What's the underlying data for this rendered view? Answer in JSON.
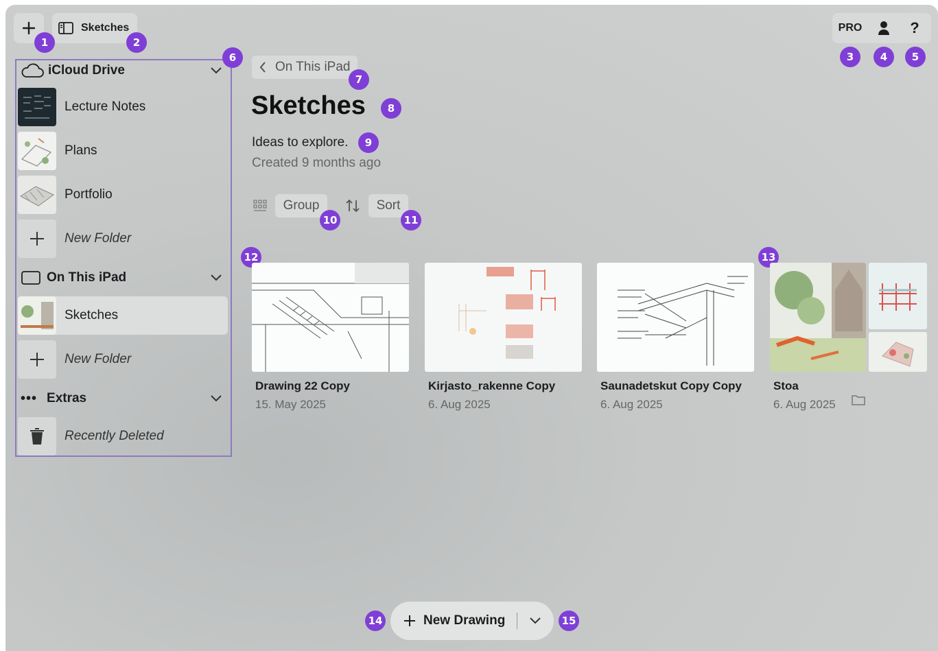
{
  "toolbar": {
    "add_icon": "plus-icon",
    "folder_label": "Sketches",
    "pro_label": "PRO",
    "account_icon": "person-icon",
    "help_label": "?"
  },
  "sidebar": {
    "icloud": {
      "title": "iCloud Drive",
      "items": [
        {
          "label": "Lecture Notes"
        },
        {
          "label": "Plans"
        },
        {
          "label": "Portfolio"
        },
        {
          "label": "New Folder"
        }
      ]
    },
    "ipad": {
      "title": "On This iPad",
      "items": [
        {
          "label": "Sketches"
        },
        {
          "label": "New Folder"
        }
      ]
    },
    "extras": {
      "title": "Extras",
      "items": [
        {
          "label": "Recently Deleted"
        }
      ]
    }
  },
  "main": {
    "back_label": "On This iPad",
    "title": "Sketches",
    "description": "Ideas to explore.",
    "created": "Created 9 months ago",
    "group_label": "Group",
    "sort_label": "Sort",
    "cards": [
      {
        "title": "Drawing 22 Copy",
        "date": "15. May 2025"
      },
      {
        "title": "Kirjasto_rakenne Copy",
        "date": "6. Aug 2025"
      },
      {
        "title": "Saunadetskut Copy Copy",
        "date": "6. Aug 2025"
      },
      {
        "title": "Stoa",
        "date": "6. Aug 2025"
      }
    ]
  },
  "footer": {
    "new_drawing_label": "New Drawing"
  },
  "badges": [
    "1",
    "2",
    "3",
    "4",
    "5",
    "6",
    "7",
    "8",
    "9",
    "10",
    "11",
    "12",
    "13",
    "14",
    "15"
  ],
  "colors": {
    "badge": "#7f3fd6",
    "sidebar_outline": "#8c7ac0",
    "background": "#c9cbcb"
  }
}
